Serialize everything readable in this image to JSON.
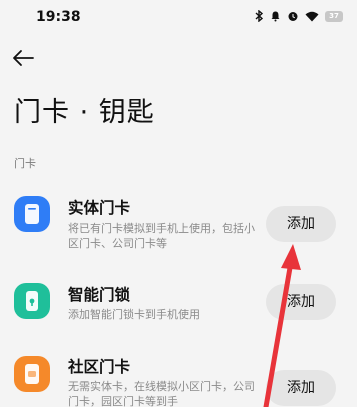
{
  "status_bar": {
    "time": "19:38",
    "battery": "37",
    "icons": [
      "bluetooth-icon",
      "mute-icon",
      "alarm-icon",
      "wifi-icon",
      "battery-icon"
    ]
  },
  "header": {
    "title": "门卡 · 钥匙",
    "back_icon": "back-arrow-icon"
  },
  "section": {
    "label": "门卡"
  },
  "items": [
    {
      "title": "实体门卡",
      "desc": "将已有门卡模拟到手机上使用，包括小区门卡、公司门卡等",
      "button": "添加",
      "icon": "card-icon",
      "icon_color": "#2f7df6"
    },
    {
      "title": "智能门锁",
      "desc": "添加智能门锁卡到手机使用",
      "button": "添加",
      "icon": "smart-lock-icon",
      "icon_color": "#1fbf9a"
    },
    {
      "title": "社区门卡",
      "desc": "无需实体卡，在线模拟小区门卡，公司门卡，园区门卡等到手",
      "button": "添加",
      "icon": "community-card-icon",
      "icon_color": "#f5892a"
    }
  ],
  "colors": {
    "background": "#f4f4f4",
    "button_bg": "#e5e5e5",
    "annotation_arrow": "#e8333a"
  }
}
